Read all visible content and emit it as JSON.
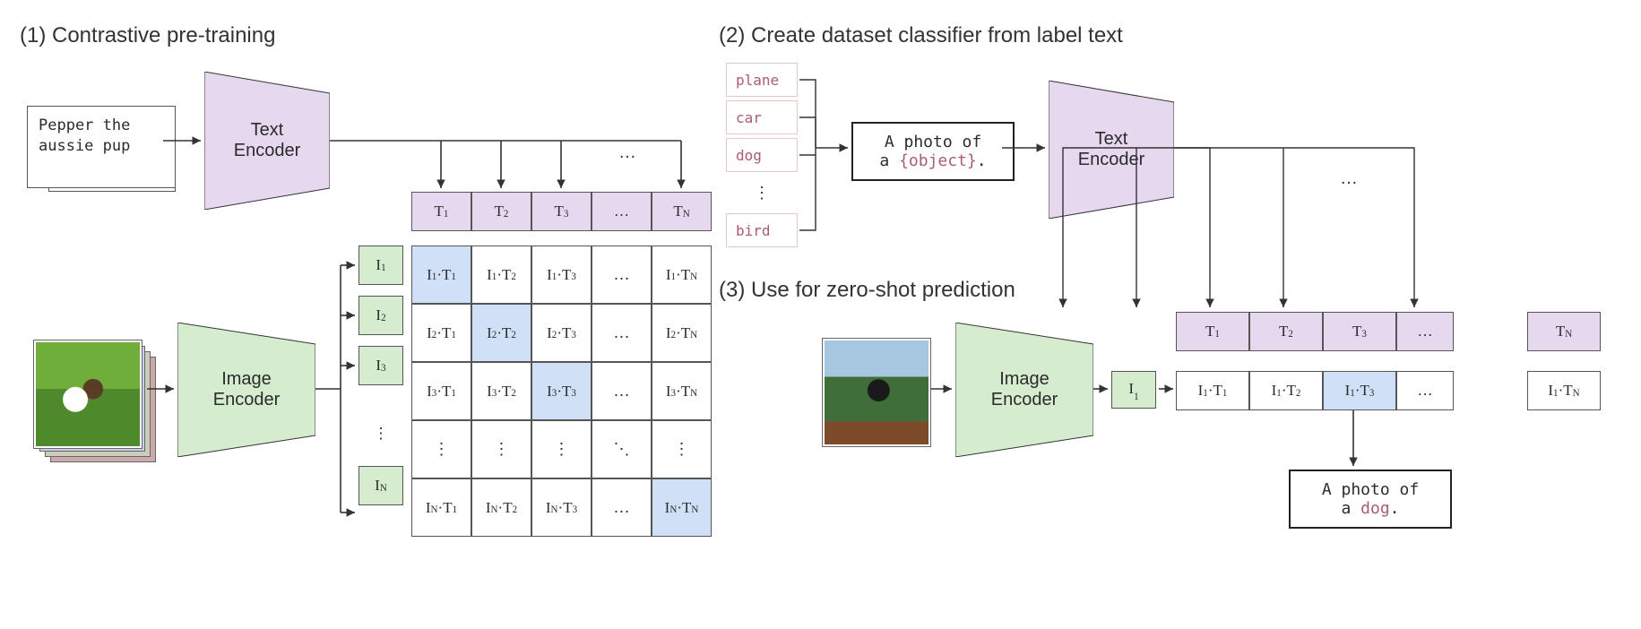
{
  "headings": {
    "h1": "(1) Contrastive pre-training",
    "h2": "(2) Create dataset classifier from label text",
    "h3": "(3) Use for zero-shot prediction"
  },
  "encoders": {
    "text": "Text\nEncoder",
    "image": "Image\nEncoder"
  },
  "input_text": "Pepper the\naussie pup",
  "labels": [
    "plane",
    "car",
    "dog",
    "bird"
  ],
  "labels_ellipsis": "⋮",
  "prompt_template_pre": "A photo of\na ",
  "prompt_template_slot": "{object}",
  "prompt_template_post": ".",
  "result_pre": "A photo of\na ",
  "result_word": "dog",
  "result_post": ".",
  "tokens": {
    "T": [
      "T₁",
      "T₂",
      "T₃",
      "…",
      "T_N"
    ],
    "I": [
      "I₁",
      "I₂",
      "I₃",
      "⋮",
      "I_N"
    ]
  },
  "matrix_rows": [
    "1",
    "2",
    "3",
    "…",
    "N"
  ],
  "matrix_cols": [
    "1",
    "2",
    "3",
    "…",
    "N"
  ],
  "right_row_I": "I₁",
  "ellipsis_h": "…",
  "ellipsis_v": "⋮",
  "ellipsis_d": "⋱"
}
